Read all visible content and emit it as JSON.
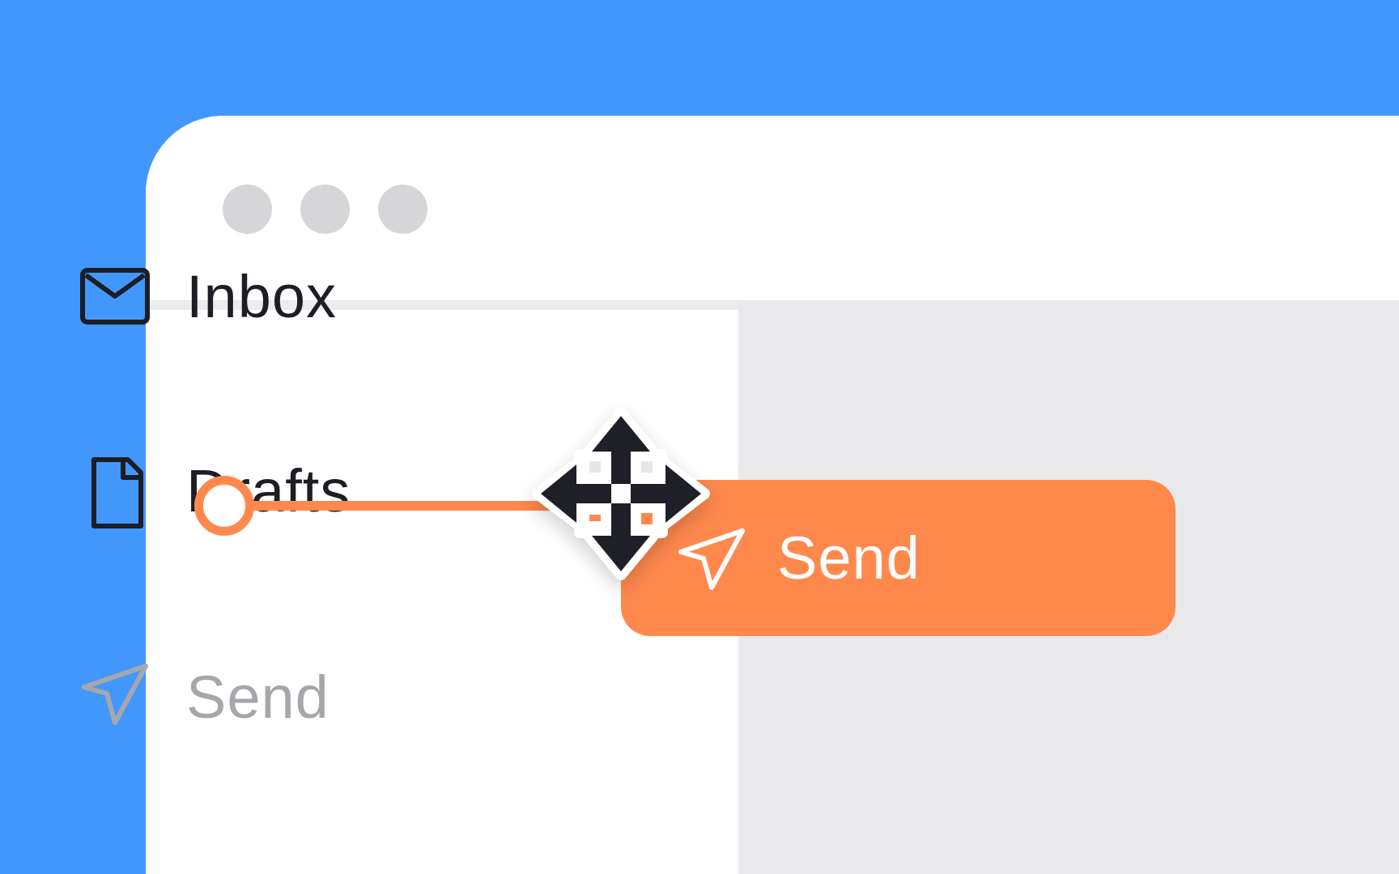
{
  "window": {
    "traffic_lights": [
      "close",
      "minimize",
      "zoom"
    ]
  },
  "sidebar": {
    "items": [
      {
        "label": "Inbox",
        "icon": "envelope-icon"
      },
      {
        "label": "Drafts",
        "icon": "document-icon"
      },
      {
        "label": "Send",
        "icon": "paper-plane-icon",
        "state": "placeholder"
      }
    ]
  },
  "drag": {
    "label": "Send",
    "icon": "paper-plane-icon",
    "cursor": "move-cursor-icon"
  },
  "colors": {
    "desktop": "#4297fd",
    "accent": "#ff894d",
    "text": "#1d1d24",
    "muted_text": "#a6a6ab",
    "content_bg": "#e9e9eb",
    "traffic_light": "#d6d6d8"
  }
}
